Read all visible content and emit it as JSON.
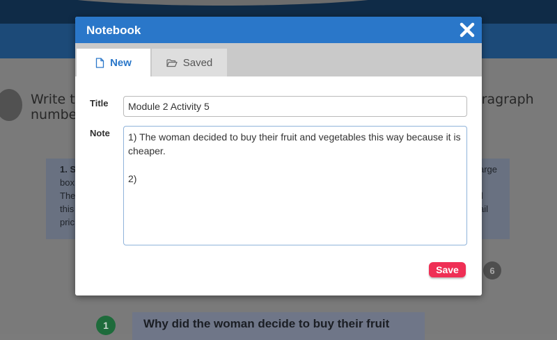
{
  "background": {
    "instruction_left": "Write t",
    "instruction_left_line2": "number",
    "instruction_right": "aragraph",
    "card_left_lines": [
      "1. S",
      "box",
      "The",
      "this",
      "pric"
    ],
    "card_right_lines": [
      "arge",
      "",
      "ll",
      "ail",
      ""
    ],
    "pages": [
      "6"
    ],
    "question_number": "1",
    "question_text": "Why did the woman decide to buy their fruit"
  },
  "dialog": {
    "title": "Notebook",
    "close_icon": "close-icon",
    "tabs": [
      {
        "label": "New",
        "icon": "file-icon",
        "active": true
      },
      {
        "label": "Saved",
        "icon": "folder-open-icon",
        "active": false
      }
    ],
    "title_label": "Title",
    "title_value": "Module 2 Activity 5",
    "note_label": "Note",
    "note_value": "1) The woman decided to buy their fruit and vegetables this way because it is cheaper.\n\n2)",
    "save_label": "Save"
  },
  "colors": {
    "header": "#2a77c9",
    "save": "#ef2f55",
    "tab_bar": "#c9c9c9"
  }
}
